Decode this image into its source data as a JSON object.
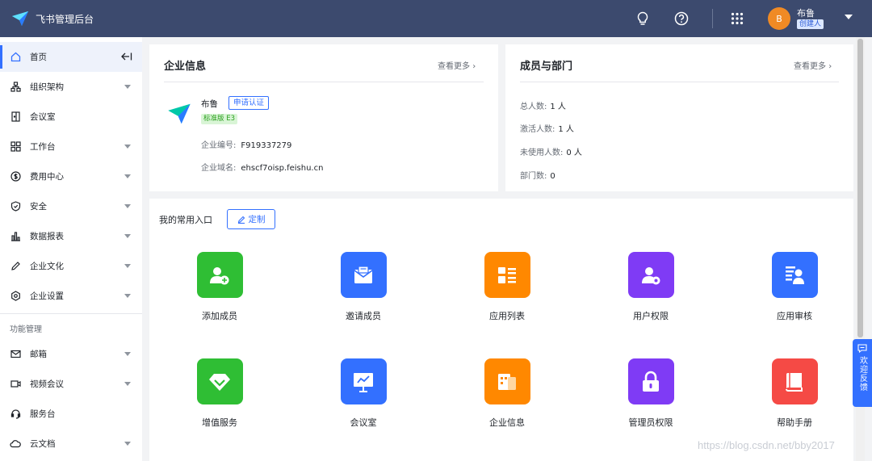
{
  "header": {
    "title": "飞书管理后台",
    "avatar_letter": "B",
    "user_name": "布鲁",
    "user_role": "创建人",
    "icons": [
      "lightbulb-icon",
      "help-icon",
      "apps-grid-icon"
    ]
  },
  "sidebar": {
    "items": [
      {
        "label": "首页",
        "icon": "home-icon",
        "active": true
      },
      {
        "label": "组织架构",
        "icon": "org-icon",
        "expandable": true
      },
      {
        "label": "会议室",
        "icon": "meeting-room-icon"
      },
      {
        "label": "工作台",
        "icon": "workbench-icon",
        "expandable": true
      },
      {
        "label": "费用中心",
        "icon": "billing-icon",
        "expandable": true
      },
      {
        "label": "安全",
        "icon": "shield-icon",
        "expandable": true
      },
      {
        "label": "数据报表",
        "icon": "bar-chart-icon",
        "expandable": true
      },
      {
        "label": "企业文化",
        "icon": "pencil-icon",
        "expandable": true
      },
      {
        "label": "企业设置",
        "icon": "settings-icon",
        "expandable": true
      }
    ],
    "section_title": "功能管理",
    "section_items": [
      {
        "label": "邮箱",
        "icon": "mail-icon",
        "expandable": true
      },
      {
        "label": "视频会议",
        "icon": "video-icon",
        "expandable": true
      },
      {
        "label": "服务台",
        "icon": "headset-icon"
      },
      {
        "label": "云文档",
        "icon": "cloud-doc-icon",
        "expandable": true
      }
    ]
  },
  "company_card": {
    "title": "企业信息",
    "more": "查看更多",
    "name": "布鲁",
    "apply_label": "申请认证",
    "edition": "标准版 E3",
    "id_label": "企业编号:",
    "id_value": "F919337279",
    "domain_label": "企业域名:",
    "domain_value": "ehscf7oisp.feishu.cn"
  },
  "members_card": {
    "title": "成员与部门",
    "more": "查看更多",
    "stats": [
      {
        "label": "总人数:",
        "value": "1 人"
      },
      {
        "label": "激活人数:",
        "value": "1 人"
      },
      {
        "label": "未使用人数:",
        "value": "0 人"
      },
      {
        "label": "部门数:",
        "value": "0"
      }
    ]
  },
  "shortcuts": {
    "title": "我的常用入口",
    "custom_label": "定制",
    "items": [
      {
        "label": "添加成员",
        "icon": "add-member-icon",
        "color": "#2fbe34"
      },
      {
        "label": "邀请成员",
        "icon": "invite-mail-icon",
        "color": "#3370ff"
      },
      {
        "label": "应用列表",
        "icon": "app-list-icon",
        "color": "#ff8800"
      },
      {
        "label": "用户权限",
        "icon": "user-permission-icon",
        "color": "#7f3bf5"
      },
      {
        "label": "应用审核",
        "icon": "app-review-icon",
        "color": "#3370ff"
      },
      {
        "label": "增值服务",
        "icon": "diamond-icon",
        "color": "#2fbe34"
      },
      {
        "label": "会议室",
        "icon": "presentation-icon",
        "color": "#3370ff"
      },
      {
        "label": "企业信息",
        "icon": "company-info-icon",
        "color": "#ff8800"
      },
      {
        "label": "管理员权限",
        "icon": "lock-icon",
        "color": "#7f3bf5"
      },
      {
        "label": "帮助手册",
        "icon": "book-icon",
        "color": "#f54a45"
      }
    ]
  },
  "feedback_label": "欢迎反馈",
  "watermark": "https://blog.csdn.net/bby2017"
}
